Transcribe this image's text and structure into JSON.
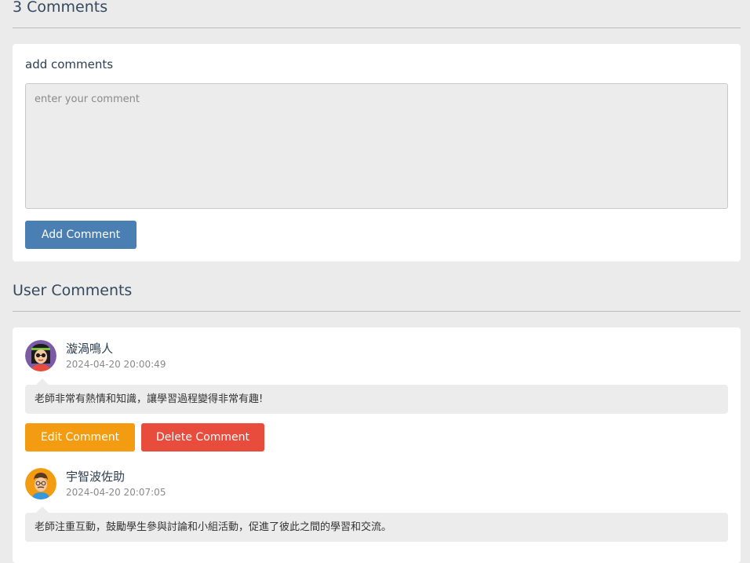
{
  "header": {
    "comment_count_title": "3 Comments"
  },
  "add_form": {
    "label": "add comments",
    "placeholder": "enter your comment",
    "submit_label": "Add Comment"
  },
  "comments_section": {
    "title": "User Comments"
  },
  "comments": [
    {
      "author": "漩渦鳴人",
      "timestamp": "2024-04-20 20:00:49",
      "text": "老師非常有熱情和知識，讓學習過程變得非常有趣!",
      "edit_label": "Edit Comment",
      "delete_label": "Delete Comment",
      "avatar_icon": "avatar-woman-sunglasses"
    },
    {
      "author": "宇智波佐助",
      "timestamp": "2024-04-20 20:07:05",
      "text": "老師注重互動，鼓勵學生參與討論和小組活動，促進了彼此之間的學習和交流。",
      "avatar_icon": "avatar-man-glasses"
    }
  ],
  "colors": {
    "primary": "#4a7fb3",
    "warning": "#f39c12",
    "danger": "#e74c3c",
    "background": "#ebebeb"
  }
}
